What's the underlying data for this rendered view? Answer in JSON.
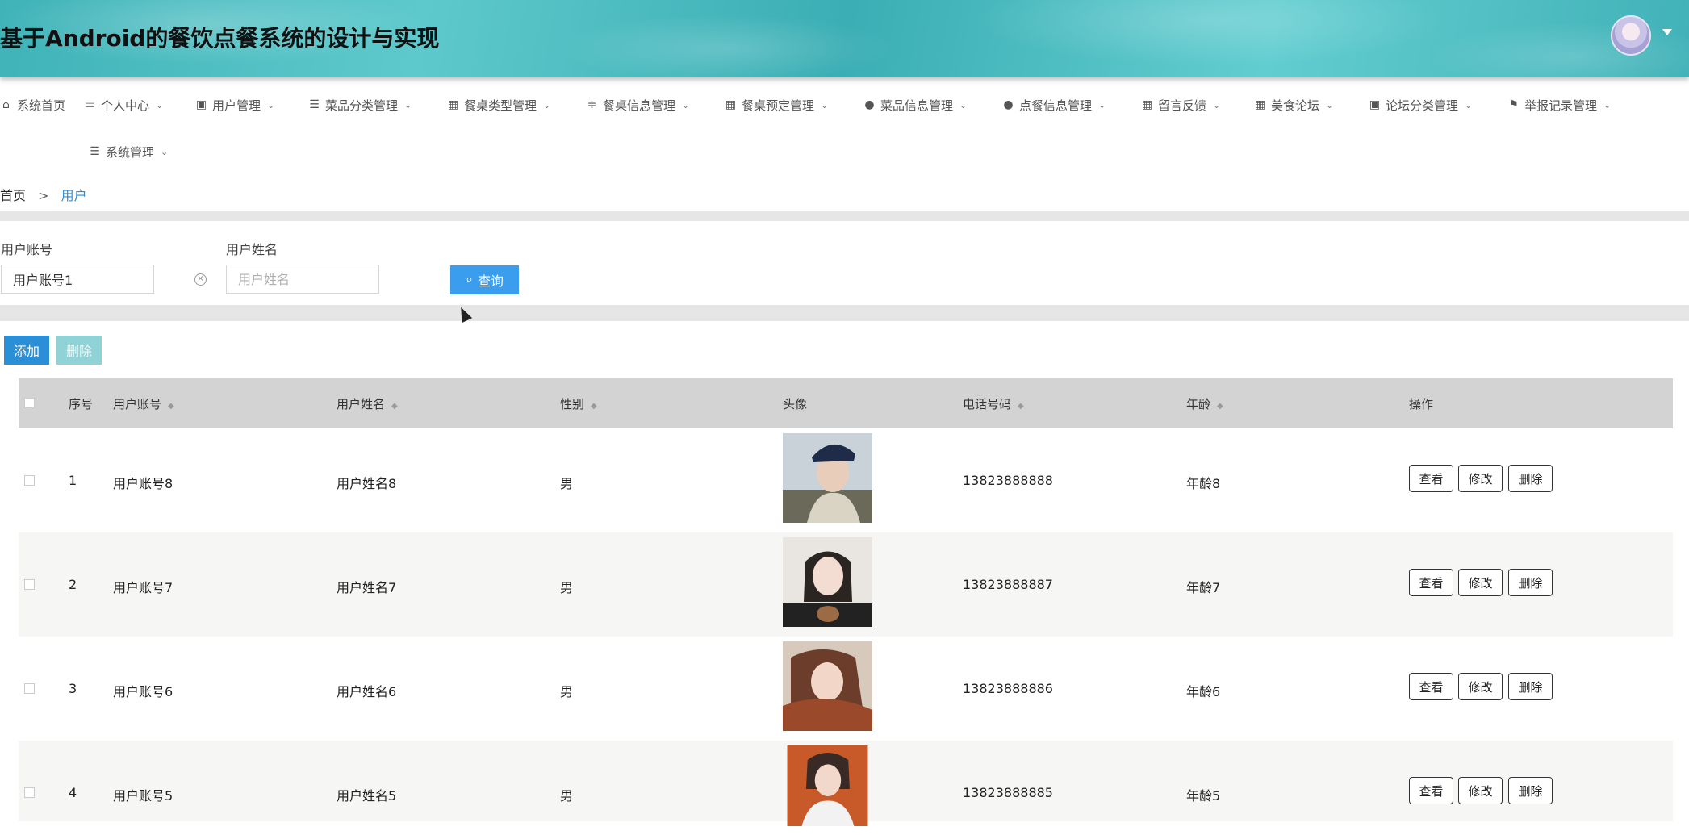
{
  "header": {
    "title": "基于Android的餐饮点餐系统的设计与实现"
  },
  "nav": [
    {
      "label": "系统首页",
      "icon": "home-icon",
      "chevron": false
    },
    {
      "label": "个人中心",
      "icon": "profile-icon",
      "chevron": true
    },
    {
      "label": "用户管理",
      "icon": "clipboard-icon",
      "chevron": true
    },
    {
      "label": "菜品分类管理",
      "icon": "list-icon",
      "chevron": true
    },
    {
      "label": "餐桌类型管理",
      "icon": "grid-icon",
      "chevron": true
    },
    {
      "label": "餐桌信息管理",
      "icon": "sliders-icon",
      "chevron": true
    },
    {
      "label": "餐桌预定管理",
      "icon": "grid-icon",
      "chevron": true
    },
    {
      "label": "菜品信息管理",
      "icon": "person-icon",
      "chevron": true
    },
    {
      "label": "点餐信息管理",
      "icon": "person-icon",
      "chevron": true
    },
    {
      "label": "留言反馈",
      "icon": "grid-icon",
      "chevron": true
    },
    {
      "label": "美食论坛",
      "icon": "grid-icon",
      "chevron": true
    },
    {
      "label": "论坛分类管理",
      "icon": "clipboard-icon",
      "chevron": true
    },
    {
      "label": "举报记录管理",
      "icon": "flag-icon",
      "chevron": true
    },
    {
      "label": "系统管理",
      "icon": "menu-icon",
      "chevron": true
    }
  ],
  "breadcrumb": {
    "home": "首页",
    "separator": ">",
    "current": "用户"
  },
  "search": {
    "account_label": "用户账号",
    "account_value": "用户账号1",
    "name_label": "用户姓名",
    "name_placeholder": "用户姓名",
    "query_label": "查询"
  },
  "actions": {
    "add_label": "添加",
    "delete_label": "删除"
  },
  "table": {
    "headers": {
      "index": "序号",
      "account": "用户账号",
      "name": "用户姓名",
      "gender": "性别",
      "avatar": "头像",
      "phone": "电话号码",
      "age": "年龄",
      "ops": "操作"
    },
    "rows": [
      {
        "index": "1",
        "account": "用户账号8",
        "name": "用户姓名8",
        "gender": "男",
        "phone": "13823888888",
        "age": "年龄8"
      },
      {
        "index": "2",
        "account": "用户账号7",
        "name": "用户姓名7",
        "gender": "男",
        "phone": "13823888887",
        "age": "年龄7"
      },
      {
        "index": "3",
        "account": "用户账号6",
        "name": "用户姓名6",
        "gender": "男",
        "phone": "13823888886",
        "age": "年龄6"
      },
      {
        "index": "4",
        "account": "用户账号5",
        "name": "用户姓名5",
        "gender": "男",
        "phone": "13823888885",
        "age": "年龄5"
      }
    ],
    "row_buttons": {
      "view": "查看",
      "edit": "修改",
      "delete": "删除"
    }
  },
  "colors": {
    "accent": "#3a9ded",
    "add_button": "#2a8fd6",
    "delete_button_disabled": "#8fd3d6",
    "header_band": "#d3d3d3"
  }
}
